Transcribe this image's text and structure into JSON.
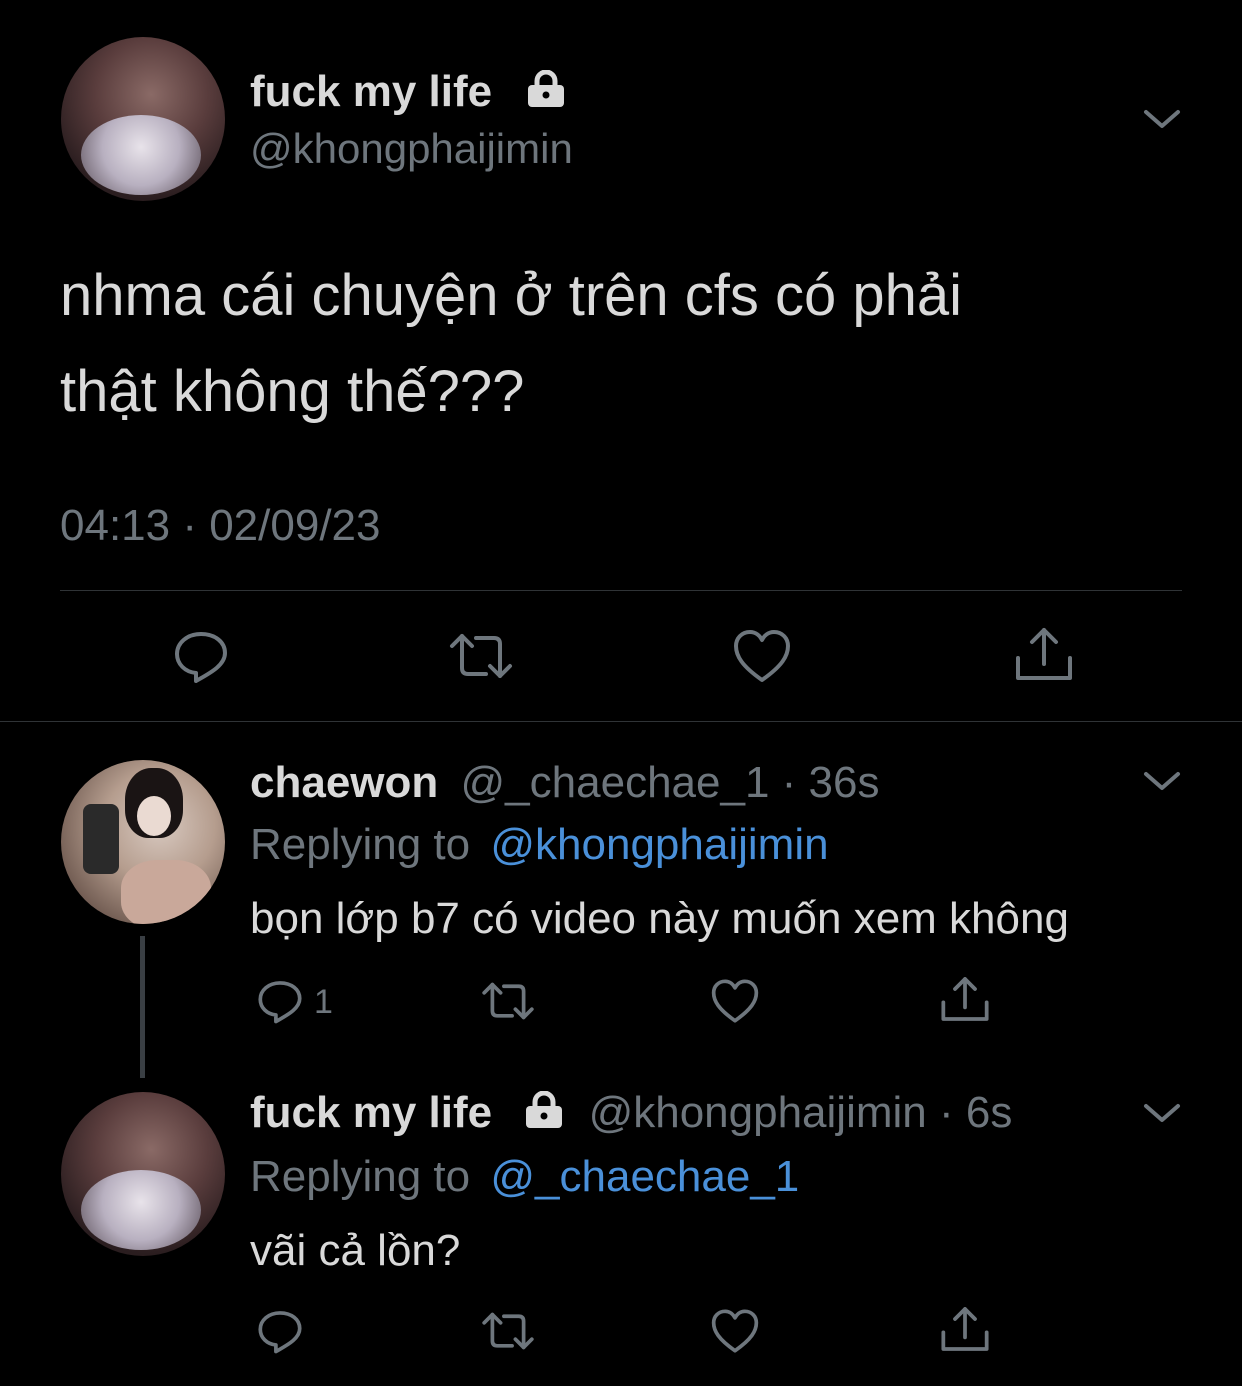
{
  "main_tweet": {
    "display_name": "fuck my life",
    "handle": "@khongphaijimin",
    "text_line1": "nhma cái chuyện ở trên cfs có phải",
    "text_line2": "thật không thế???",
    "timestamp": "04:13 · 02/09/23",
    "avatar_icon": "avatar-photo",
    "lock_icon": "lock-icon",
    "more_icon": "chevron-down-icon"
  },
  "actions": {
    "reply_icon": "reply-icon",
    "retweet_icon": "retweet-icon",
    "like_icon": "heart-icon",
    "share_icon": "share-icon"
  },
  "reply1": {
    "display_name": "chaewon",
    "handle": "@_chaechae_1",
    "time": "· 36s",
    "replying_prefix": "Replying to",
    "replying_handle": "@khongphaijimin",
    "text": "bọn lớp b7 có video này muốn xem không",
    "reply_count": "1"
  },
  "reply2": {
    "display_name": "fuck my life",
    "handle": "@khongphaijimin",
    "time": "· 6s",
    "replying_prefix": "Replying to",
    "replying_handle": "@_chaechae_1",
    "text": "vãi cả lồn?"
  },
  "colors": {
    "background": "#000000",
    "text": "#d9d9d9",
    "muted": "#6e767d",
    "link": "#4a90d9",
    "divider": "#2f3336"
  }
}
